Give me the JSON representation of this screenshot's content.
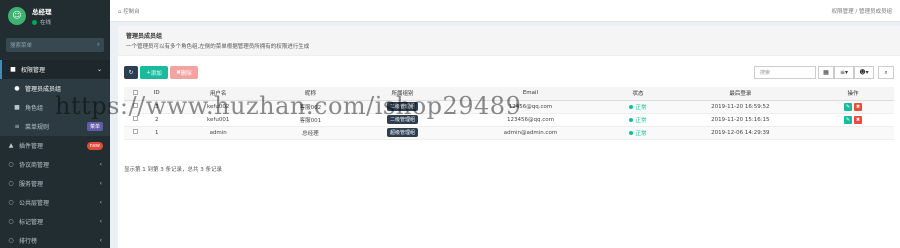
{
  "user": {
    "name": "总经理",
    "status": "在线"
  },
  "sidebar": {
    "search_placeholder": "搜索菜单",
    "items": [
      {
        "label": "权限管理",
        "icon": "group-icon"
      },
      {
        "label": "管理员成员组",
        "icon": "user-icon"
      },
      {
        "label": "角色组",
        "icon": "group-icon"
      },
      {
        "label": "菜单规则",
        "icon": "bars-icon",
        "tag": "菜单"
      },
      {
        "label": "插件管理",
        "icon": "rocket-icon",
        "badge": "new"
      },
      {
        "label": "协议商管理",
        "icon": "circle-icon"
      },
      {
        "label": "服务管理",
        "icon": "circle-icon"
      },
      {
        "label": "公共层管理",
        "icon": "circle-icon"
      },
      {
        "label": "标记管理",
        "icon": "circle-icon"
      },
      {
        "label": "排行榜",
        "icon": "circle-icon"
      }
    ]
  },
  "header": {
    "left": "控制台",
    "right_1": "权限管理",
    "right_2": "管理员成员组"
  },
  "panel": {
    "title": "管理员成员组",
    "description": "一个管理员可以有多个角色组,左侧的菜单根据管理员所拥有的权限进行生成"
  },
  "toolbar": {
    "add_label": "添加",
    "delete_label": "删除",
    "search_placeholder": "搜索"
  },
  "table": {
    "columns": [
      "ID",
      "用户名",
      "昵称",
      "所属组别",
      "Email",
      "状态",
      "最后登录",
      "操作"
    ],
    "rows": [
      {
        "id": "3",
        "username": "kefu002",
        "nickname": "客服002",
        "group": "二级管理组",
        "email": "12456@qq.com",
        "status": "正常",
        "last_login": "2019-11-20 16:59:52"
      },
      {
        "id": "2",
        "username": "kefu001",
        "nickname": "客服001",
        "group": "二级管理组",
        "email": "123456@qq.com",
        "status": "正常",
        "last_login": "2019-11-20 15:16:15"
      },
      {
        "id": "1",
        "username": "admin",
        "nickname": "总经理",
        "group": "超级管理组",
        "email": "admin@admin.com",
        "status": "正常",
        "last_login": "2019-12-06 14:29:39"
      }
    ]
  },
  "footer": "显示第 1 到第 3 条记录，总共 3 条记录",
  "watermark": "https://www.huzhan.com/ishop29489"
}
